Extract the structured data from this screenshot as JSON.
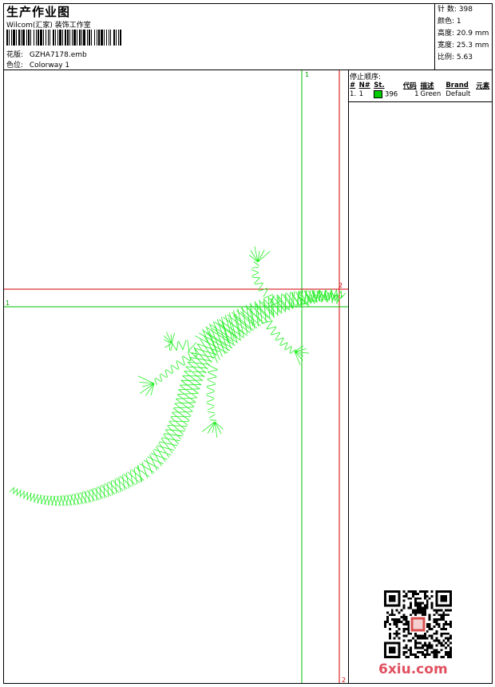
{
  "header": {
    "title": "生产作业图",
    "subtitle": "Wilcom(汇家) 装饰工作室",
    "design_label": "花版:",
    "design_value": "GZHA7178.emb",
    "colorway_label": "色位:",
    "colorway_value": "Colorway 1"
  },
  "stats": [
    {
      "label": "针 数:",
      "value": "398"
    },
    {
      "label": "颜色:",
      "value": "1"
    },
    {
      "label": "高度:",
      "value": "20.9 mm"
    },
    {
      "label": "宽度:",
      "value": "25.3 mm"
    },
    {
      "label": "比例:",
      "value": "5.63"
    }
  ],
  "guides": {
    "v1_label": "1",
    "h1_label": "1",
    "h2_label": "2",
    "v2_label": "2",
    "green_color": "#00c000",
    "red_color": "#d00000"
  },
  "embroidery": {
    "thread_color": "#22ee22"
  },
  "stop_sequence": {
    "title": "停止顺序:",
    "columns": [
      "#",
      "N#",
      "St.",
      "代码",
      "描述",
      "Brand",
      "元素"
    ],
    "rows": [
      {
        "index": "1.",
        "n": "1",
        "stitches": "396",
        "code": "1",
        "desc": "Green",
        "brand": "Default",
        "color": "#00cc00"
      }
    ]
  },
  "watermark": {
    "text": "6xiu.com"
  }
}
